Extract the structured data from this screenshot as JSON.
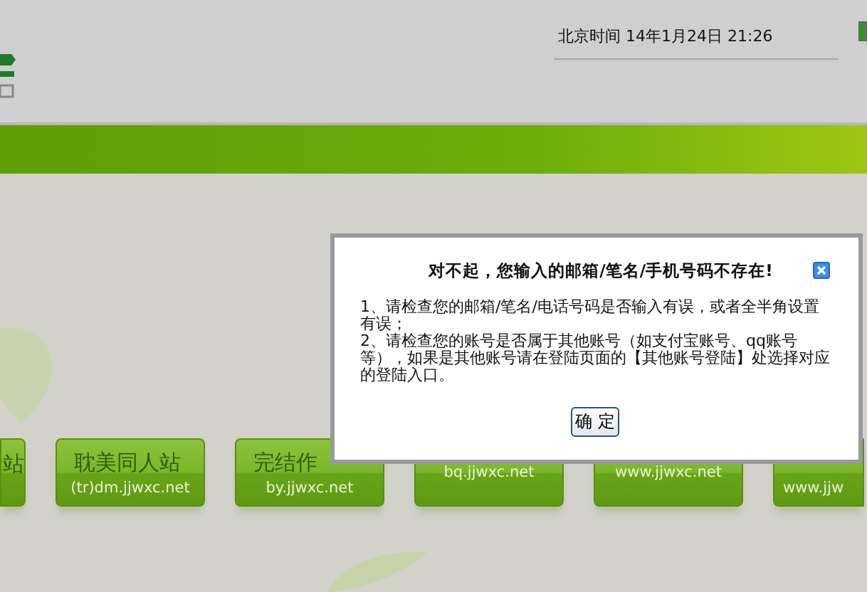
{
  "header": {
    "clock": "北京时间 14年1月24日 21:26"
  },
  "tiles": [
    {
      "kind": "partial_left",
      "title": "站"
    },
    {
      "kind": "full",
      "title": "耽美同人站",
      "url": "(tr)dm.jjwxc.net"
    },
    {
      "kind": "full",
      "title": "完结作",
      "url": "by.jjwxc.net"
    },
    {
      "kind": "full",
      "url": "bq.jjwxc.net"
    },
    {
      "kind": "full",
      "url": "www.jjwxc.net"
    },
    {
      "kind": "partial_right",
      "url": "www.jjw"
    }
  ],
  "dialog": {
    "title": "对不起，您输入的邮箱/笔名/手机号码不存在!",
    "lines": [
      "1、请检查您的邮箱/笔名/电话号码是否输入有误，或者全半角设置有误；",
      "2、请检查您的账号是否属于其他账号（如支付宝账号、qq账号等），如果是其他账号请在登陆页面的【其他账号登陆】处选择对应的登陆入口。"
    ],
    "button": "确 定"
  }
}
